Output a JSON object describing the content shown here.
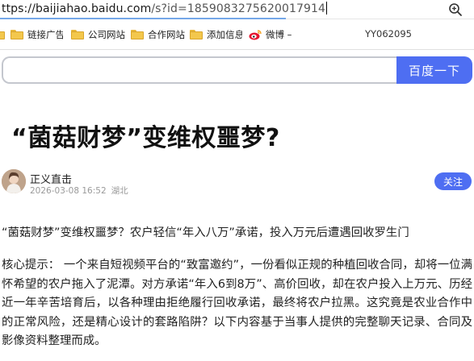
{
  "browser": {
    "address": {
      "host_part": "ttps://baijiahao.baidu.com",
      "path_part": "/s?id=1859083275620017914"
    },
    "zoom_icon": "magnifier-zoom-icon"
  },
  "bookmarks": [
    {
      "label": "",
      "icon": "folder-icon"
    },
    {
      "label": "链接广告",
      "icon": "folder-icon"
    },
    {
      "label": "公司网站",
      "icon": "folder-icon"
    },
    {
      "label": "合作网站",
      "icon": "folder-icon"
    },
    {
      "label": "添加信息",
      "icon": "folder-icon"
    },
    {
      "label": "微博 –",
      "icon": "weibo-icon"
    },
    {
      "label": "YY062095",
      "icon": ""
    }
  ],
  "search": {
    "value": "",
    "button_label": "百度一下"
  },
  "article": {
    "title": "“菌菇财梦”变维权噩梦?",
    "author": {
      "name": "正义直击",
      "date": "2026-03-08 16:52",
      "location": "湖北",
      "follow_label": "关注"
    },
    "subtitle": "“菌菇财梦”变维权噩梦？农户轻信“年入八万”承诺，投入万元后遭遇回收罗生门",
    "paragraph": "核心提示： 一个来自短视频平台的“致富邀约”，一份看似正规的种植回收合同，却将一位满怀希望的农户拖入了泥潭。对方承诺“年入6到8万”、高价回收，却在农户投入上万元、历经近一年辛苦培育后，以各种理由拒绝履行回收承诺，最终将农户拉黑。这究竟是农业合作中的正常风险，还是精心设计的套路陷阱？以下内容基于当事人提供的完整聊天记录、合同及影像资料整理而成。"
  },
  "colors": {
    "accent": "#4e6ef2",
    "meta_gray": "#9a9a9a"
  }
}
